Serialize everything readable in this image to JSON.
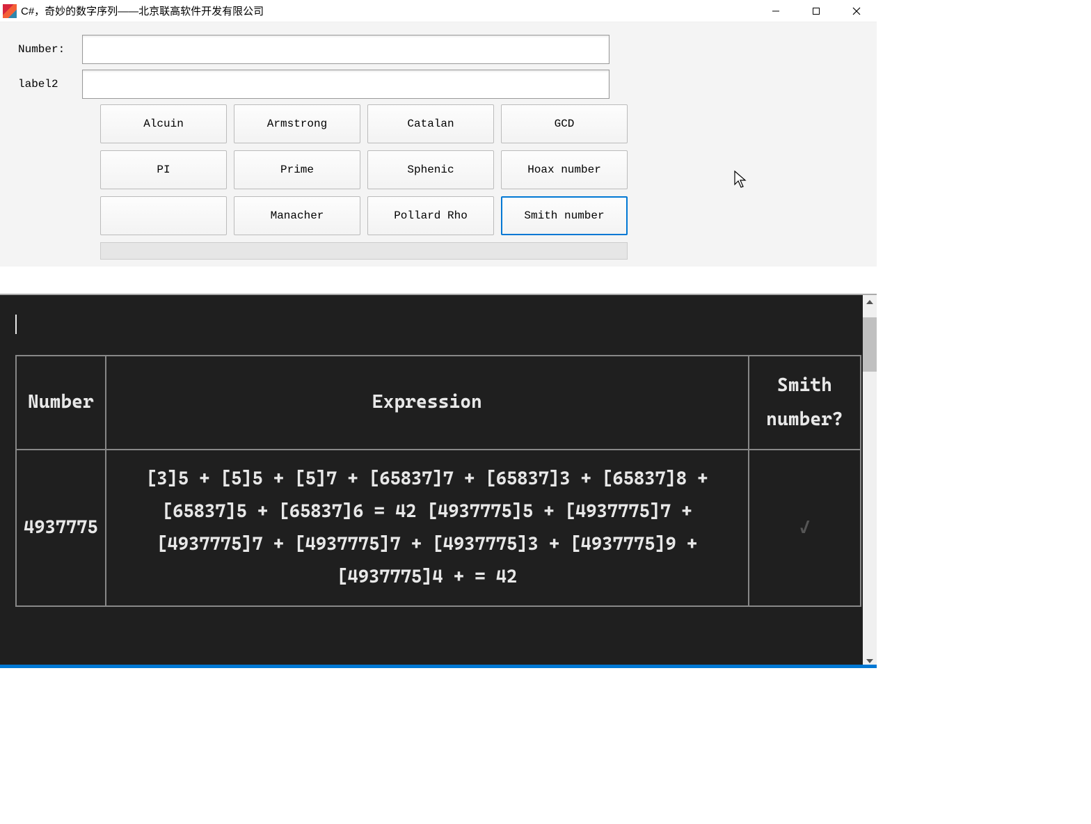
{
  "window": {
    "title": "C#，奇妙的数字序列——北京联高软件开发有限公司"
  },
  "form": {
    "label_number": "Number:",
    "label2": "label2",
    "input_number": "",
    "input_label2": ""
  },
  "buttons": [
    "Alcuin",
    "Armstrong",
    "Catalan",
    "GCD",
    "PI",
    "Prime",
    "Sphenic",
    "Hoax number",
    "",
    "Manacher",
    "Pollard Rho",
    "Smith number"
  ],
  "selected_button_index": 11,
  "table": {
    "headers": [
      "Number",
      "Expression",
      "Smith number?"
    ],
    "rows": [
      {
        "number": "4937775",
        "expression": "[3]5 + [5]5 + [5]7 + [65837]7 + [65837]3 + [65837]8 + [65837]5 + [65837]6 = 42 [4937775]5 + [4937775]7 + [4937775]7 + [4937775]7 + [4937775]3 + [4937775]9 + [4937775]4 + = 42",
        "is_smith": "✓"
      }
    ]
  }
}
